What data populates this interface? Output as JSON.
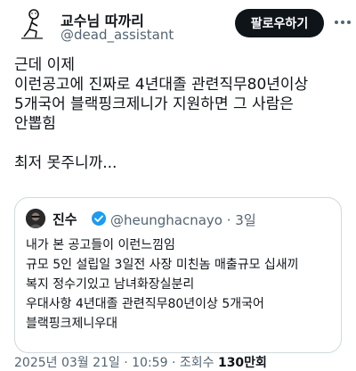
{
  "author": {
    "display_name": "교수님 따까리",
    "handle": "@dead_assistant",
    "avatar_icon": "stick-figure-sitting-icon"
  },
  "header": {
    "follow_label": "팔로우하기"
  },
  "tweet": {
    "text": "근데 이제\n이런공고에 진짜로 4년대졸 관련직무80년이상\n5개국어 블랙핑크제니가 지원하면 그 사람은\n안뽑힘\n\n최저 못주니까..."
  },
  "quote": {
    "display_name": "진수",
    "handle_time": "@heunghacnayo · 3일",
    "text": "내가 본 공고들이 이런느낌임\n규모 5인 설립일 3일전 사장 미친놈 매출규모 십새끼\n복지 정수기있고 남녀화장실분리\n우대사항 4년대졸 관련직무80년이상 5개국어\n블랙핑크제니우대"
  },
  "meta": {
    "timestamp": "2025년 03월 21일 · 10:59 · 조회수",
    "views": "130만회"
  },
  "colors": {
    "text": "#0f1419",
    "secondary": "#536471",
    "verified": "#1d9bf0",
    "border": "#cfd9de",
    "button": "#0f1419"
  }
}
